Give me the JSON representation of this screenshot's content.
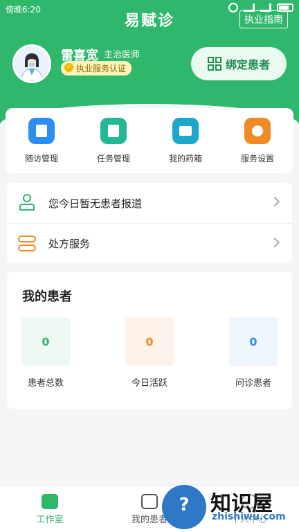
{
  "status_bar": {
    "time": "傍晚6:20"
  },
  "header": {
    "app_title": "易赋诊",
    "guide_button": "执业指南"
  },
  "doctor": {
    "name": "雷喜宽",
    "title": "主治医师",
    "certification": "执业服务认证",
    "bind_button": "绑定患者"
  },
  "quick_actions": [
    {
      "label": "随访管理",
      "icon": "followup-doc-icon",
      "color": "#2b8ef0"
    },
    {
      "label": "任务管理",
      "icon": "task-book-icon",
      "color": "#23b796"
    },
    {
      "label": "我的药箱",
      "icon": "medicine-box-icon",
      "color": "#1fa7c9"
    },
    {
      "label": "服务设置",
      "icon": "service-hex-icon",
      "color": "#f08a24"
    }
  ],
  "list": [
    {
      "label": "您今日暂无患者报道",
      "icon": "person-icon"
    },
    {
      "label": "处方服务",
      "icon": "pill-icon"
    }
  ],
  "patients": {
    "title": "我的患者",
    "stats": [
      {
        "value": "0",
        "caption": "患者总数",
        "color": "#2fb86b",
        "bg": "#eef9f3"
      },
      {
        "value": "0",
        "caption": "今日活跃",
        "color": "#f08a24",
        "bg": "#fdf3ea"
      },
      {
        "value": "0",
        "caption": "问诊患者",
        "color": "#2b8ef0",
        "bg": "#eef5fd"
      }
    ]
  },
  "tabs": [
    {
      "label": "工作室",
      "active": true
    },
    {
      "label": "我的患者",
      "active": false
    },
    {
      "label": "个人中心",
      "active": false
    }
  ],
  "watermark": {
    "brand": "知识屋",
    "url": "zhishiwu.com",
    "mark": "?"
  },
  "colors": {
    "primary": "#2fb86b"
  }
}
